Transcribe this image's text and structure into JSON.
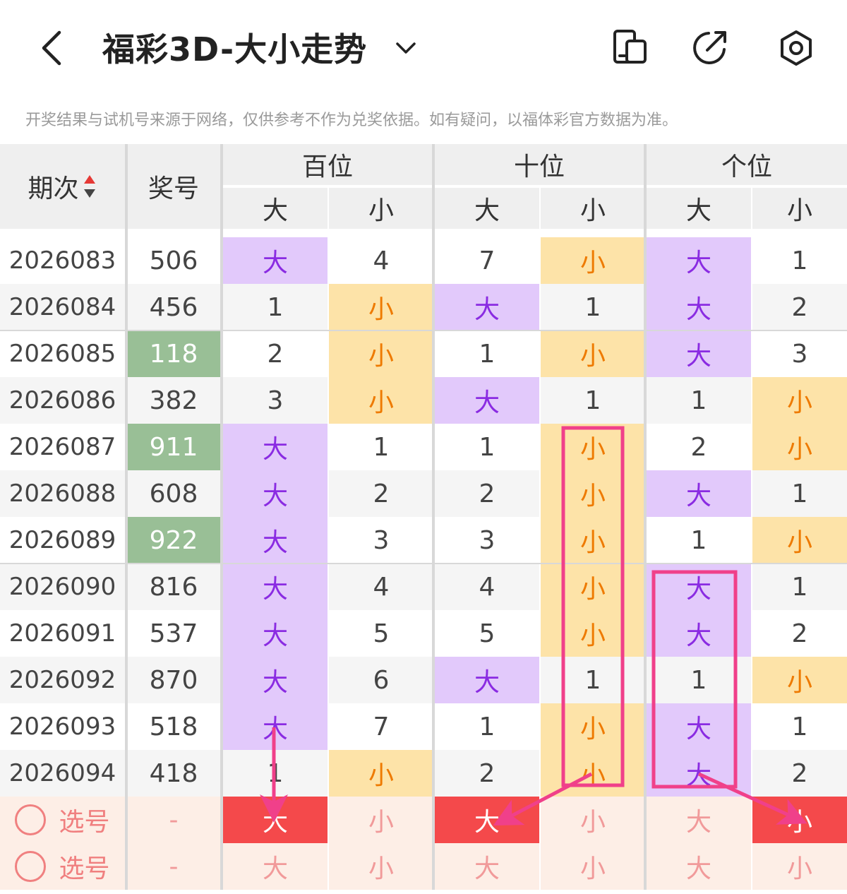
{
  "header": {
    "title": "福彩3D-大小走势",
    "icons": [
      "back-arrow-icon",
      "chevron-down-icon",
      "phone-tablet-icon",
      "share-icon",
      "settings-icon"
    ]
  },
  "notice": "开奖结果与试机号来源于网络，仅供参考不作为兑奖依据。如有疑问，以福体彩官方数据为准。",
  "table": {
    "col_period": "期次",
    "col_number": "奖号",
    "groups": [
      "百位",
      "十位",
      "个位"
    ],
    "sub": [
      "大",
      "小"
    ],
    "rows": [
      {
        "period": "2026083",
        "number": "506",
        "highlight": false,
        "cells": [
          "大",
          "4",
          "7",
          "小",
          "大",
          "1"
        ]
      },
      {
        "period": "2026084",
        "number": "456",
        "highlight": false,
        "cells": [
          "1",
          "小",
          "大",
          "1",
          "大",
          "2"
        ]
      },
      {
        "period": "2026085",
        "number": "118",
        "highlight": true,
        "cells": [
          "2",
          "小",
          "1",
          "小",
          "大",
          "3"
        ]
      },
      {
        "period": "2026086",
        "number": "382",
        "highlight": false,
        "cells": [
          "3",
          "小",
          "大",
          "1",
          "1",
          "小"
        ]
      },
      {
        "period": "2026087",
        "number": "911",
        "highlight": true,
        "cells": [
          "大",
          "1",
          "1",
          "小",
          "2",
          "小"
        ]
      },
      {
        "period": "2026088",
        "number": "608",
        "highlight": false,
        "cells": [
          "大",
          "2",
          "2",
          "小",
          "大",
          "1"
        ]
      },
      {
        "period": "2026089",
        "number": "922",
        "highlight": true,
        "cells": [
          "大",
          "3",
          "3",
          "小",
          "1",
          "小"
        ]
      },
      {
        "period": "2026090",
        "number": "816",
        "highlight": false,
        "cells": [
          "大",
          "4",
          "4",
          "小",
          "大",
          "1"
        ]
      },
      {
        "period": "2026091",
        "number": "537",
        "highlight": false,
        "cells": [
          "大",
          "5",
          "5",
          "小",
          "大",
          "2"
        ]
      },
      {
        "period": "2026092",
        "number": "870",
        "highlight": false,
        "cells": [
          "大",
          "6",
          "大",
          "1",
          "1",
          "小"
        ]
      },
      {
        "period": "2026093",
        "number": "518",
        "highlight": false,
        "cells": [
          "大",
          "7",
          "1",
          "小",
          "大",
          "1"
        ]
      },
      {
        "period": "2026094",
        "number": "418",
        "highlight": false,
        "cells": [
          "1",
          "小",
          "2",
          "小",
          "大",
          "2"
        ]
      }
    ],
    "select_rows": [
      {
        "label": "选号",
        "dash": "-",
        "cells": [
          "大",
          "小",
          "大",
          "小",
          "大",
          "小"
        ],
        "selected": [
          0,
          2,
          5
        ]
      },
      {
        "label": "选号",
        "dash": "-",
        "cells": [
          "大",
          "小",
          "大",
          "小",
          "大",
          "小"
        ],
        "selected": []
      }
    ]
  },
  "colors": {
    "big": "#e2c9fb",
    "small": "#fde3a8",
    "repeat": "#99bf96",
    "selected": "#f4494b",
    "annotation": "#f0408a"
  }
}
